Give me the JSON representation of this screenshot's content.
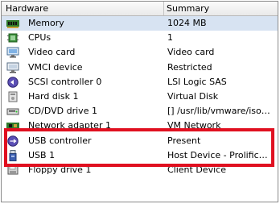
{
  "columns": {
    "hardware": "Hardware",
    "summary": "Summary"
  },
  "rows": [
    {
      "name": "Memory",
      "summary": "1024 MB",
      "icon": "memory-icon"
    },
    {
      "name": "CPUs",
      "summary": "1",
      "icon": "cpu-icon"
    },
    {
      "name": "Video card",
      "summary": "Video card",
      "icon": "monitor-icon"
    },
    {
      "name": "VMCI device",
      "summary": "Restricted",
      "icon": "vmci-icon"
    },
    {
      "name": "SCSI controller 0",
      "summary": "LSI Logic SAS",
      "icon": "scsi-controller-icon"
    },
    {
      "name": "Hard disk 1",
      "summary": "Virtual Disk",
      "icon": "hard-disk-icon"
    },
    {
      "name": "CD/DVD drive 1",
      "summary": "[] /usr/lib/vmware/isoi...",
      "icon": "cd-dvd-icon"
    },
    {
      "name": "Network adapter 1",
      "summary": "VM Network",
      "icon": "network-adapter-icon"
    },
    {
      "name": "USB controller",
      "summary": "Present",
      "icon": "usb-controller-icon"
    },
    {
      "name": "USB 1",
      "summary": "Host Device - Prolific U...",
      "icon": "usb-device-icon"
    },
    {
      "name": "Floppy drive 1",
      "summary": "Client Device",
      "icon": "floppy-icon"
    }
  ],
  "colors": {
    "selection": "#d7e3f2",
    "highlight_border": "#e01020"
  }
}
